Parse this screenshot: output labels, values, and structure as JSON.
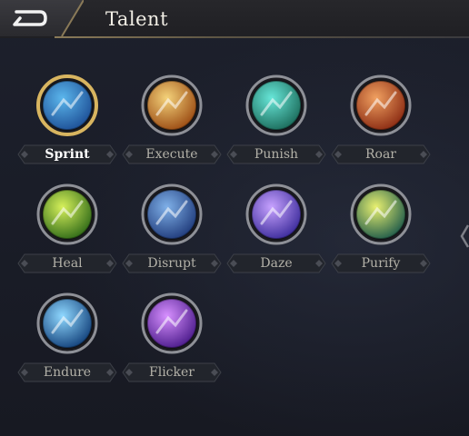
{
  "header": {
    "title": "Talent"
  },
  "talents": [
    {
      "label": "Sprint",
      "icon": "sprint-icon",
      "selected": true,
      "colors": [
        "#5bb6ec",
        "#1d4f96"
      ]
    },
    {
      "label": "Execute",
      "icon": "execute-icon",
      "selected": false,
      "colors": [
        "#f4d27a",
        "#9a4a12"
      ]
    },
    {
      "label": "Punish",
      "icon": "punish-icon",
      "selected": false,
      "colors": [
        "#67e6d8",
        "#1b6b5a"
      ]
    },
    {
      "label": "Roar",
      "icon": "roar-icon",
      "selected": false,
      "colors": [
        "#f0a060",
        "#8a2a12"
      ]
    },
    {
      "label": "Heal",
      "icon": "heal-icon",
      "selected": false,
      "colors": [
        "#d6f05a",
        "#2f6a18"
      ]
    },
    {
      "label": "Disrupt",
      "icon": "disrupt-icon",
      "selected": false,
      "colors": [
        "#7fb0e8",
        "#1f3a7a"
      ]
    },
    {
      "label": "Daze",
      "icon": "daze-icon",
      "selected": false,
      "colors": [
        "#c7a2ff",
        "#3a2a9a"
      ]
    },
    {
      "label": "Purify",
      "icon": "purify-icon",
      "selected": false,
      "colors": [
        "#e8f070",
        "#1e5a4a"
      ]
    },
    {
      "label": "Endure",
      "icon": "endure-icon",
      "selected": false,
      "colors": [
        "#8fd8ff",
        "#12407a"
      ]
    },
    {
      "label": "Flicker",
      "icon": "flicker-icon",
      "selected": false,
      "colors": [
        "#d790ff",
        "#4a1a8a"
      ]
    }
  ],
  "colors": {
    "frame_gold": "#d8b560",
    "frame_silver": "#8e9097",
    "label_text": "#b3b1a8",
    "label_selected": "#ffffff"
  }
}
